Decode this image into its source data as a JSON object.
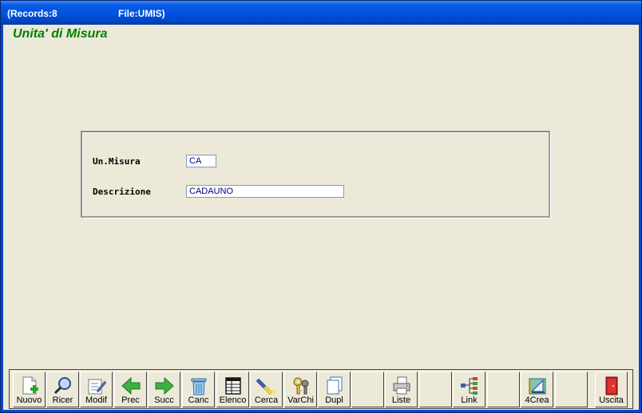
{
  "titlebar": {
    "records": "(Records:8",
    "file": "File:UMIS)"
  },
  "form": {
    "title": "Unita' di Misura",
    "fields": {
      "misura": {
        "label": "Un.Misura",
        "value": "CA"
      },
      "descrizione": {
        "label": "Descrizione",
        "value": "CADAUNO"
      }
    }
  },
  "toolbar": {
    "nuovo": "Nuovo",
    "ricer": "Ricer",
    "modif": "Modif",
    "prec": "Prec",
    "succ": "Succ",
    "canc": "Canc",
    "elenco": "Elenco",
    "cerca": "Cerca",
    "varchi": "VarChi",
    "dupl": "Dupl",
    "liste": "Liste",
    "link": "Link",
    "crea": "4Crea",
    "uscita": "Uscita"
  },
  "colors": {
    "title_green": "#008000",
    "field_text": "#000080",
    "window_bg": "#ECE9D8"
  }
}
